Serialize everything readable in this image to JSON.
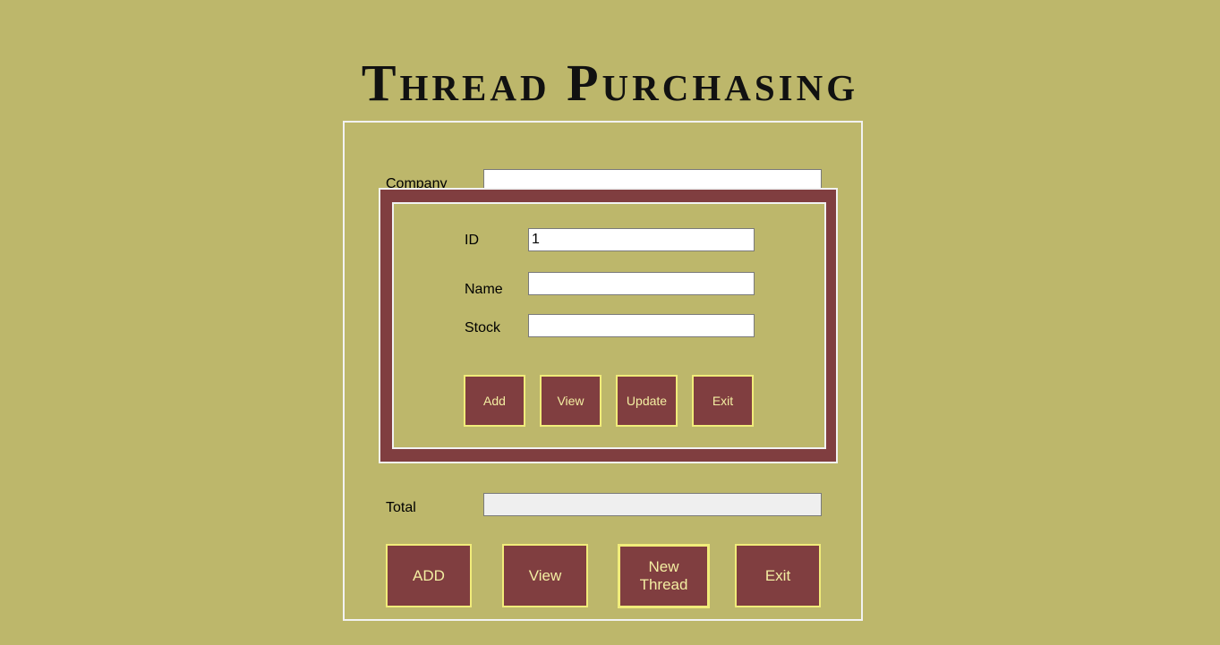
{
  "title": "Thread Purchasing",
  "form": {
    "company_label": "Company",
    "company_value": "",
    "total_label": "Total",
    "total_value": "",
    "buttons": {
      "add": "ADD",
      "view": "View",
      "new_thread": "New Thread",
      "exit": "Exit"
    }
  },
  "dialog": {
    "id_label": "ID",
    "id_value": "1",
    "name_label": "Name",
    "name_value": "",
    "stock_label": "Stock",
    "stock_value": "",
    "buttons": {
      "add": "Add",
      "view": "View",
      "update": "Update",
      "exit": "Exit"
    }
  },
  "colors": {
    "background": "#bdb76b",
    "button": "#803e40",
    "button_border": "#f1ec7a",
    "button_text": "#f3eea2"
  }
}
